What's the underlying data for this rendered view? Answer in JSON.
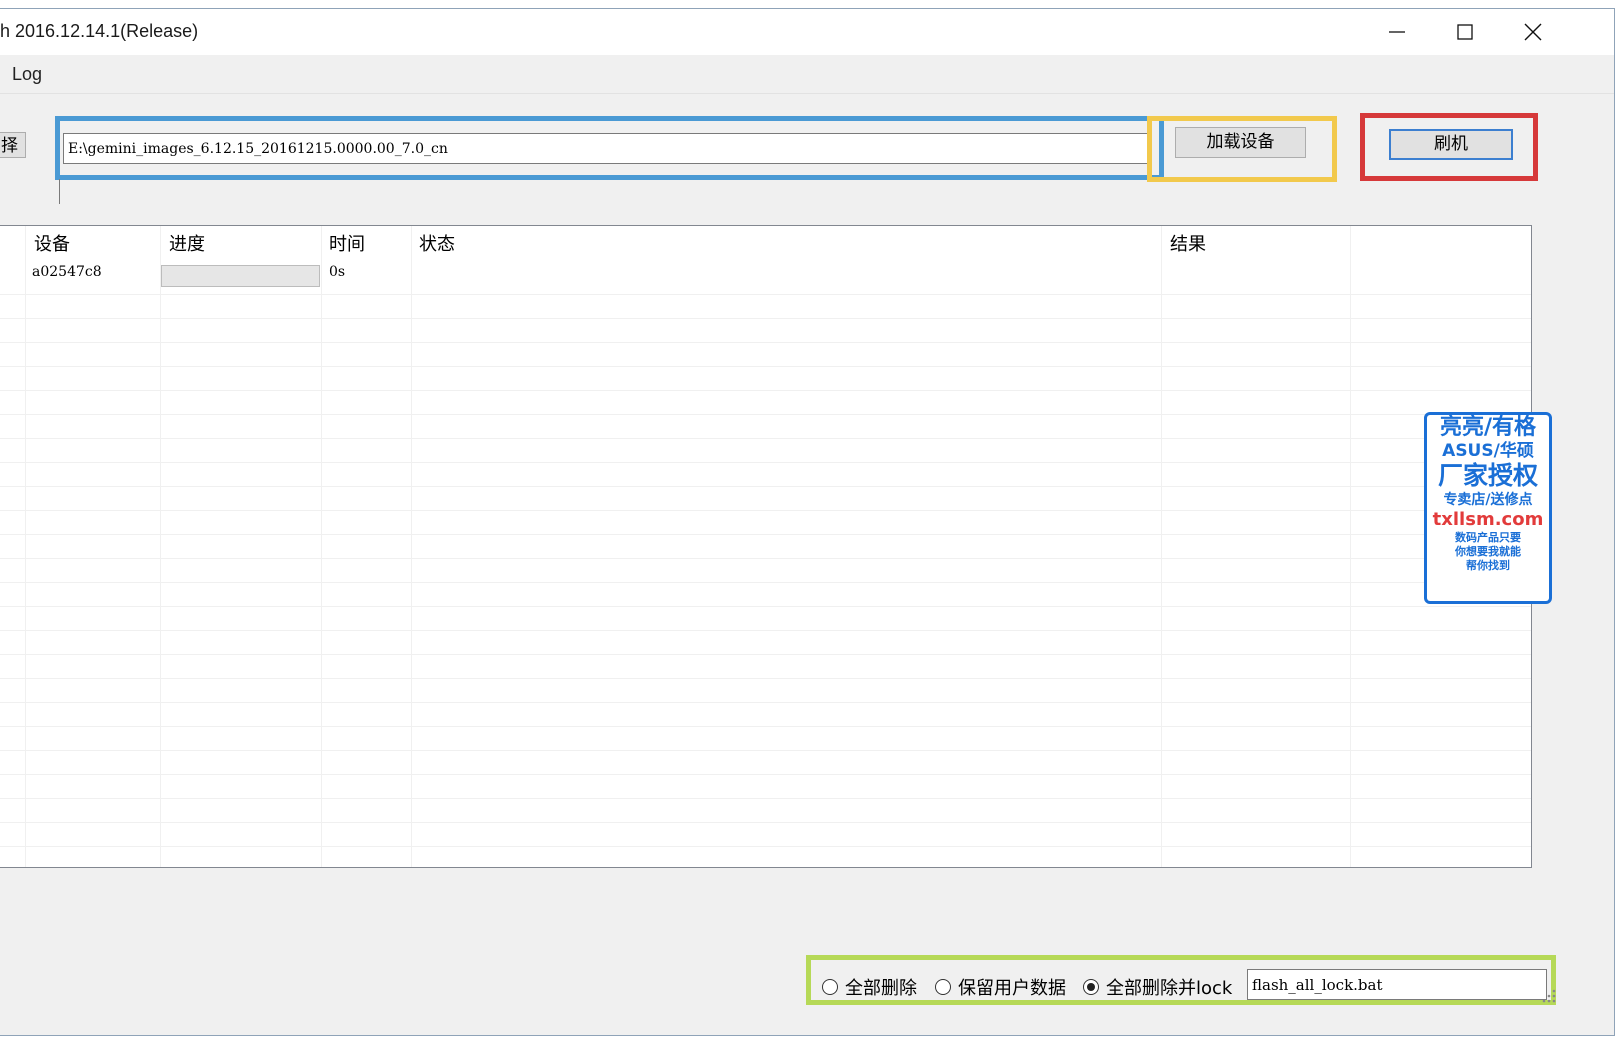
{
  "window": {
    "title": "h 2016.12.14.1(Release)"
  },
  "menu": {
    "items": [
      "Log"
    ]
  },
  "path_row": {
    "select_label": "择",
    "path_value": "E:\\gemini_images_6.12.15_20161215.0000.00_7.0_cn",
    "load_button": "加载设备",
    "flash_button": "刷机"
  },
  "table": {
    "headers": [
      "设备",
      "进度",
      "时间",
      "状态",
      "结果"
    ],
    "rows": [
      {
        "device": "a02547c8",
        "progress": 0,
        "time": "0s",
        "status": "",
        "result": ""
      }
    ]
  },
  "stamp": {
    "line1": "亮亮/有格",
    "line2": "ASUS/华硕",
    "line3": "厂家授权",
    "line4": "专卖店/送修点",
    "line5": "txllsm.com",
    "line6": "数码产品只要",
    "line7": "你想要我就能",
    "line8": "帮你找到"
  },
  "options": {
    "radio_all_delete": "全部删除",
    "radio_keep_user": "保留用户数据",
    "radio_delete_lock": "全部删除并lock",
    "selected": "radio_delete_lock",
    "script_value": "flash_all_lock.bat"
  },
  "colors": {
    "highlight_blue": "#4a9ad4",
    "highlight_yellow": "#f2c94c",
    "highlight_red": "#d6393a",
    "highlight_green": "#b6d957",
    "stamp_blue": "#1a6fd6"
  }
}
